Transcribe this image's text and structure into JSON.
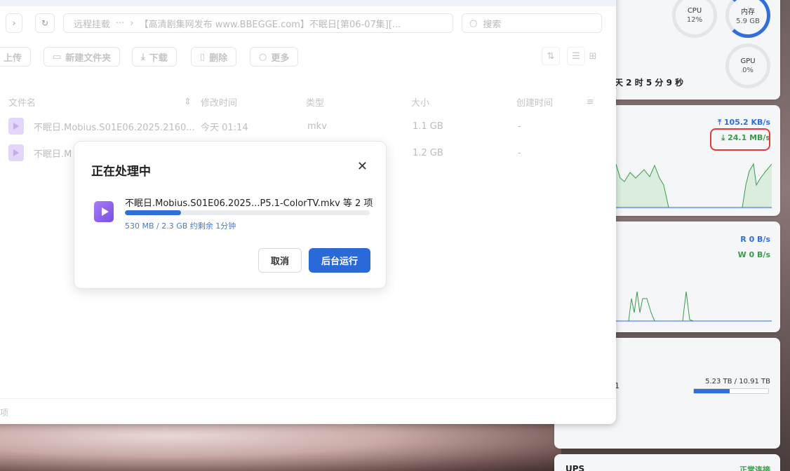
{
  "monitor": {
    "cpu_label": "CPU",
    "cpu_value": "12%",
    "mem_label": "内存",
    "mem_value": "5.9 GB",
    "gpu_label": "GPU",
    "gpu_value": "0%",
    "uptime": "天 2 时 5 分 9 秒",
    "net_up": "105.2 KB/s",
    "net_down": "24.1 MB/s",
    "disk_read": "R  0 B/s",
    "disk_write": "W  0 B/s",
    "storage_label": "1",
    "storage_size": "5.23 TB / 10.91 TB",
    "storage_used_fraction": 0.48,
    "ups_label": "UPS",
    "ups_status": "正常连接"
  },
  "colors": {
    "accent": "#2f6fd8",
    "success": "#3a9b4a",
    "highlight": "#e03a3a",
    "file_icon": "#a77cf6"
  },
  "filemanager": {
    "path": {
      "items": [
        "远程挂载",
        "···",
        "›",
        "【高清剧集网发布 www.BBEGGE.com】不眠日[第06-07集][..."
      ]
    },
    "search_placeholder": "搜索",
    "toolbar": {
      "upload": "上传",
      "new_folder": "新建文件夹",
      "download": "下载",
      "delete": "删除",
      "more": "更多"
    },
    "columns": {
      "name": "文件名",
      "modified": "修改时间",
      "type": "类型",
      "size": "大小",
      "created": "创建时间"
    },
    "rows": [
      {
        "name": "不眠日.Mobius.S01E06.2025.2160...",
        "modified": "今天 01:14",
        "type": "mkv",
        "size": "1.1 GB",
        "created": "-"
      },
      {
        "name": "不眠日.M",
        "modified": "",
        "type": "",
        "size": "1.2 GB",
        "created": "-"
      }
    ],
    "footer": "项"
  },
  "dialog": {
    "title": "正在处理中",
    "file": "不眠日.Mobius.S01E06.2025...P5.1-ColorTV.mkv 等 2 项",
    "progress": 0.23,
    "status": "530 MB / 2.3 GB 约剩余 1分钟",
    "cancel_label": "取消",
    "background_label": "后台运行"
  }
}
